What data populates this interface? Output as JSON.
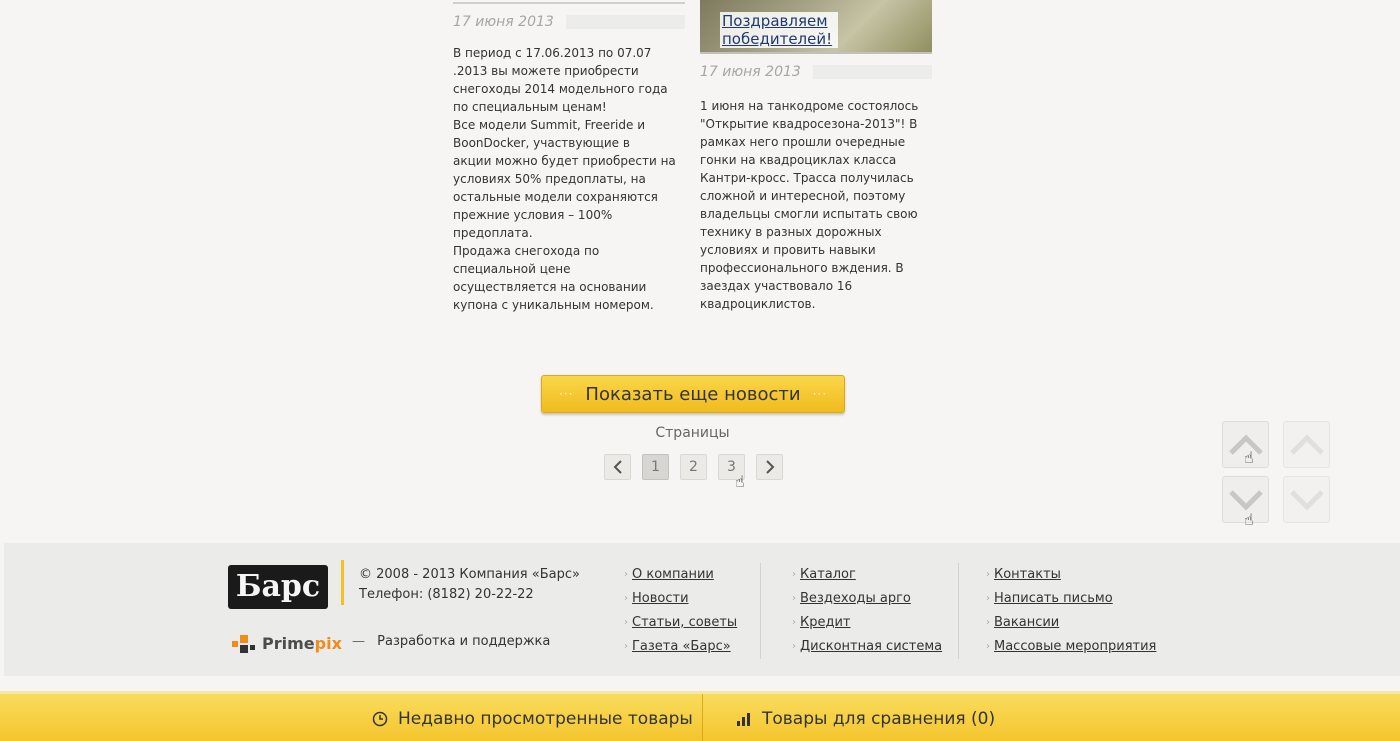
{
  "news": [
    {
      "date": "17 июня 2013",
      "text": "В период с 17.06.2013 по 07.07\n.2013 вы можете приобрести\nснегоходы 2014 модельного года\nпо специальным ценам!\nВсе модели Summit, Freeride и\nBoonDocker, участвующие в\nакции можно будет приобрести на\nусловиях 50% предоплаты, на\nостальные модели сохраняются\nпрежние условия – 100%\nпредоплата.\nПродажа снегохода по\nспециальной цене\nосуществляется на основании\nкупона с уникальным номером."
    },
    {
      "caption": "Поздравляем победителей!",
      "date": "17 июня 2013",
      "text": "1 июня на танкодроме состоялось\n\"Открытие квадросезона-2013\"! В\nрамках него прошли очередные\nгонки на квадроциклах класса\nКантри-кросс. Трасса получилась\nсложной и интересной, поэтому\nвладельцы смогли испытать свою\nтехнику в разных дорожных\nусловиях и провить навыки\nпрофессионального вждения. В\nзаездах участвовало 16\nквадроциклистов."
    }
  ],
  "more_button": {
    "label": "Показать еще новости",
    "dots": "···"
  },
  "pagination": {
    "label": "Страницы",
    "prev": "‹",
    "next": "›",
    "pages": [
      "1",
      "2",
      "3"
    ],
    "current": "1"
  },
  "footer": {
    "logo_text": "Барс",
    "copyright": "© 2008 - 2013 Компания «Барс»",
    "phone": "Телефон: (8182) 20-22-22",
    "dev_brand": {
      "part1": "Prime",
      "part2": "pix"
    },
    "dev_dash": "—",
    "dev_link": "Разработка и поддержка",
    "menu1": [
      "О компании",
      "Новости",
      "Статьи, советы",
      "Газета «Барс»"
    ],
    "menu2": [
      "Каталог",
      "Вездеходы арго",
      "Кредит",
      "Дисконтная система"
    ],
    "menu3": [
      "Контакты",
      "Написать письмо",
      "Вакансии",
      "Массовые мероприятия"
    ]
  },
  "bottom_bar": {
    "recent": "Недавно просмотренные товары",
    "compare": "Товары для сравнения (0)"
  },
  "colors": {
    "accent": "#f4c025",
    "link": "#1f3a6e"
  }
}
